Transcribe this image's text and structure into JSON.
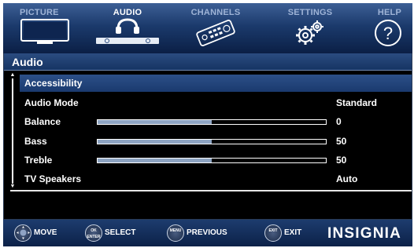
{
  "tabs": [
    {
      "id": "picture",
      "label": "PICTURE",
      "icon": "tv-icon"
    },
    {
      "id": "audio",
      "label": "AUDIO",
      "icon": "headphones-icon",
      "active": true
    },
    {
      "id": "channels",
      "label": "CHANNELS",
      "icon": "remote-icon"
    },
    {
      "id": "settings",
      "label": "SETTINGS",
      "icon": "gears-icon"
    },
    {
      "id": "help",
      "label": "HELP",
      "icon": "question-icon"
    }
  ],
  "panel": {
    "title": "Audio",
    "items": [
      {
        "label": "Accessibility",
        "highlighted": true
      },
      {
        "label": "Audio Mode",
        "value": "Standard"
      },
      {
        "label": "Balance",
        "value": "0",
        "slider_fraction": 0.5
      },
      {
        "label": "Bass",
        "value": "50",
        "slider_fraction": 0.5
      },
      {
        "label": "Treble",
        "value": "50",
        "slider_fraction": 0.5
      },
      {
        "label": "TV Speakers",
        "value": "Auto"
      }
    ]
  },
  "footer": {
    "hints": [
      {
        "button": "",
        "label": "MOVE"
      },
      {
        "button": "OK\nENTER",
        "label": "SELECT"
      },
      {
        "button": "MENU",
        "label": "PREVIOUS"
      },
      {
        "button": "EXIT",
        "label": "EXIT"
      }
    ],
    "brand": "INSIGNIA"
  },
  "colors": {
    "highlight": "#1f3f73",
    "slider_fill": "#8ea4c2",
    "inactive_tab": "#9fb4d7"
  }
}
